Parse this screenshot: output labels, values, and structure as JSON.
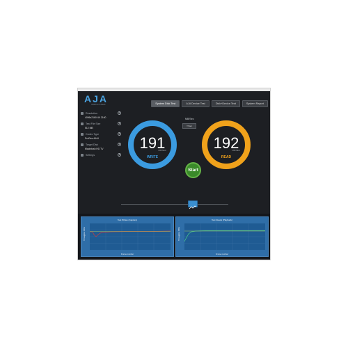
{
  "logo": {
    "text": "AJA",
    "subtitle": "VIDEO SYSTEMS"
  },
  "tabs": [
    "System Disk Test",
    "AJA Device Test",
    "Disk+Device Test",
    "System Report"
  ],
  "sidebar": {
    "resolution": {
      "label": "Resolution",
      "value": "4096x2160 4K 2160"
    },
    "file_size": {
      "label": "Test File Size",
      "value": "512 MB"
    },
    "codec": {
      "label": "Codec Type",
      "value": "ProRes 4444"
    },
    "target": {
      "label": "Target Disk",
      "value": "Macintosh HD TV"
    },
    "settings": {
      "label": "Settings"
    }
  },
  "units": {
    "label": "MB/Sec",
    "button": "Y/Sec"
  },
  "write": {
    "value": "191",
    "unit": "MB/SEC",
    "label": "WRITE"
  },
  "read": {
    "value": "192",
    "unit": "MB/SEC",
    "label": "READ"
  },
  "start_label": "Start",
  "charts": {
    "write": {
      "title": "Test Writes (Capture)",
      "ylabel": "Throughput MB/s",
      "xlabel": "Frame number"
    },
    "read": {
      "title": "Test Reads (Playback)",
      "ylabel": "Throughput MB/s",
      "xlabel": "Frame number"
    }
  },
  "colors": {
    "write": "#3b9be0",
    "read": "#f0a21b",
    "start": "#3a8a2a",
    "panel": "#2f6ea8"
  }
}
